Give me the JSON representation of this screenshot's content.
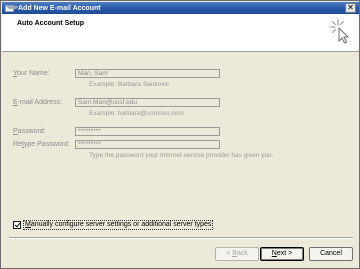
{
  "window": {
    "title": "Add New E-mail Account",
    "close_label": "✕"
  },
  "header": {
    "title": "Auto Account Setup"
  },
  "form": {
    "your_name": {
      "label_hotkey": "Y",
      "label_rest": "our Name:",
      "value": "Man, Sam",
      "hint": "Example: Barbara Sankovic"
    },
    "email": {
      "label_hotkey": "E",
      "label_rest": "-mail Address:",
      "value": "Sam.Man@ucsf.edu",
      "hint": "Example: barbara@contoso.com"
    },
    "password": {
      "label_hotkey": "P",
      "label_rest": "assword:",
      "value": "*********"
    },
    "retype_password": {
      "label_pre": "Re",
      "label_hotkey": "t",
      "label_rest": "ype Password:",
      "value": "*********",
      "hint": "Type the password your Internet service provider has given you."
    }
  },
  "manual_config": {
    "checked": true,
    "label_hotkey": "M",
    "label_rest": "anually configure server settings or additional server types"
  },
  "buttons": {
    "back": {
      "pre": "< ",
      "hotkey": "B",
      "rest": "ack",
      "enabled": false
    },
    "next": {
      "hotkey": "N",
      "rest": "ext >",
      "enabled": true
    },
    "cancel": {
      "label": "Cancel",
      "enabled": true
    }
  },
  "colors": {
    "title_bar": "#2b5aa8",
    "dialog_background": "#ece9d8",
    "disabled_text": "#8c8c8c"
  }
}
